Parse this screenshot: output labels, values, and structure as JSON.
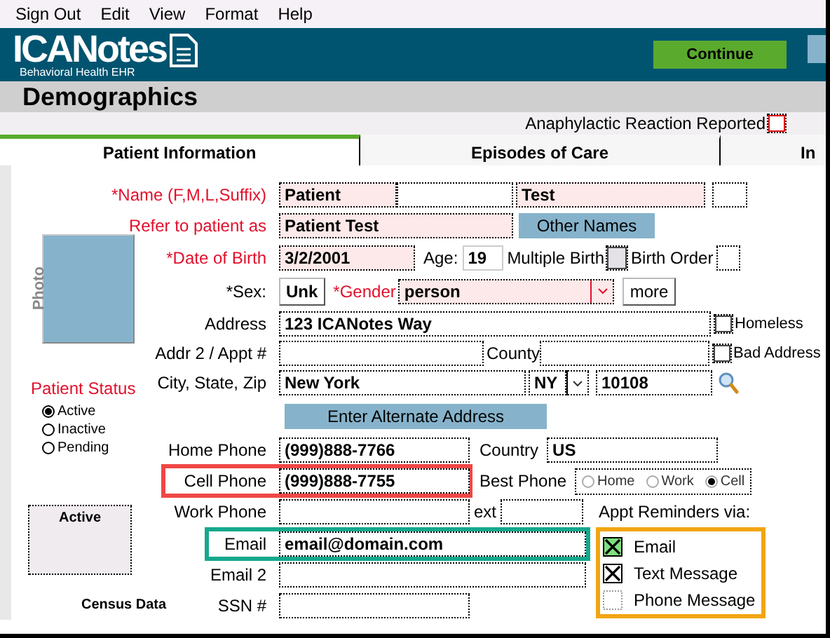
{
  "menu": [
    "Sign Out",
    "Edit",
    "View",
    "Format",
    "Help"
  ],
  "header": {
    "logo": "ICANotes",
    "tagline": "Behavioral Health EHR",
    "continue_button": "Continue"
  },
  "page_title": "Demographics",
  "anaphylactic": {
    "label": "Anaphylactic Reaction Reported",
    "checked": false
  },
  "tabs": [
    {
      "label": "Patient Information",
      "selected": true
    },
    {
      "label": "Episodes of Care",
      "selected": false
    },
    {
      "label": "In",
      "selected": false
    }
  ],
  "photo": {
    "label": "Photo"
  },
  "patient_status": {
    "title": "Patient Status",
    "options": [
      {
        "label": "Active",
        "selected": true
      },
      {
        "label": "Inactive",
        "selected": false
      },
      {
        "label": "Pending",
        "selected": false
      }
    ]
  },
  "status_box": {
    "label": "Active"
  },
  "census_data": "Census Data",
  "name": {
    "label": "*Name (F,M,L,Suffix)",
    "required": true,
    "first": "Patient",
    "last": "Test"
  },
  "refer_as": {
    "label": "Refer to patient as",
    "required": true,
    "value": "Patient Test",
    "button": "Other Names"
  },
  "date_of_birth": {
    "label": "*Date of Birth",
    "required": true,
    "value": "3/2/2001",
    "age_label": "Age:",
    "age": "19",
    "multiple_birth_label": "Multiple Birth",
    "multiple_birth": false,
    "birth_order_label": "Birth Order"
  },
  "sex": {
    "label": "*Sex:",
    "value": "Unk",
    "gender_label": "*Gender",
    "gender": "person",
    "more_button": "more"
  },
  "address": {
    "label": "Address",
    "value": "123 ICANotes Way",
    "homeless_label": "Homeless",
    "homeless": false
  },
  "address_2": {
    "label": "Addr 2 / Appt #",
    "county_label": "County",
    "bad_address_label": "Bad Address",
    "bad_address": false
  },
  "city_state_zip": {
    "label": "City, State, Zip",
    "city": "New York",
    "state": "NY",
    "zip": "10108"
  },
  "alternate_address_button": "Enter Alternate Address",
  "home_phone": {
    "label": "Home Phone",
    "value": "(999)888-7766",
    "country_label": "Country",
    "country": "US"
  },
  "cell_phone": {
    "label": "Cell Phone",
    "value": "(999)888-7755",
    "best_phone_label": "Best Phone",
    "best_phone_options": [
      {
        "label": "Home",
        "selected": false
      },
      {
        "label": "Work",
        "selected": false
      },
      {
        "label": "Cell",
        "selected": true
      }
    ]
  },
  "work_phone": {
    "label": "Work Phone",
    "ext_label": "ext"
  },
  "email": {
    "label": "Email",
    "value": "email@domain.com"
  },
  "email_2": {
    "label": "Email 2"
  },
  "ssn": {
    "label": "SSN #"
  },
  "appt_reminders": {
    "title": "Appt Reminders via:",
    "options": [
      {
        "label": "Email",
        "checked": true,
        "focused": true
      },
      {
        "label": "Text Message",
        "checked": true,
        "focused": false
      },
      {
        "label": "Phone Message",
        "checked": false,
        "focused": false
      }
    ]
  }
}
